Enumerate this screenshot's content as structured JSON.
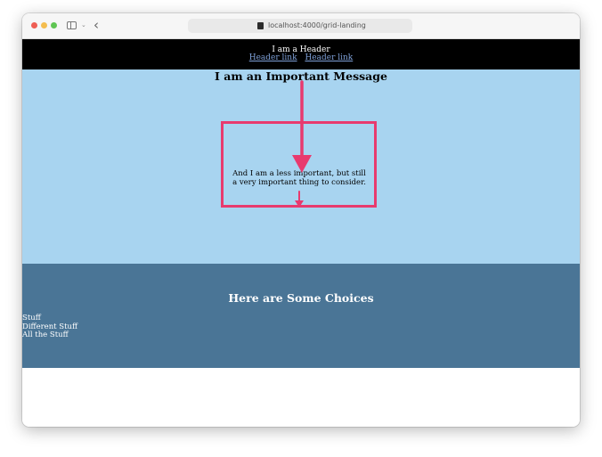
{
  "browser": {
    "url": "localhost:4000/grid-landing"
  },
  "site_header": {
    "title": "I am a Header",
    "links": [
      "Header link",
      "Header link"
    ]
  },
  "hero": {
    "title": "I am an Important Message",
    "subtitle": "And I am a less important, but still a very important thing to consider."
  },
  "choices": {
    "title": "Here are Some Choices",
    "items": [
      "Stuff",
      "Different Stuff",
      "All the Stuff"
    ]
  },
  "colors": {
    "header_bg": "#000000",
    "hero_bg": "#a8d4f0",
    "choices_bg": "#4a7596",
    "annotation": "#e83a6e",
    "link": "#7ea0d8"
  }
}
